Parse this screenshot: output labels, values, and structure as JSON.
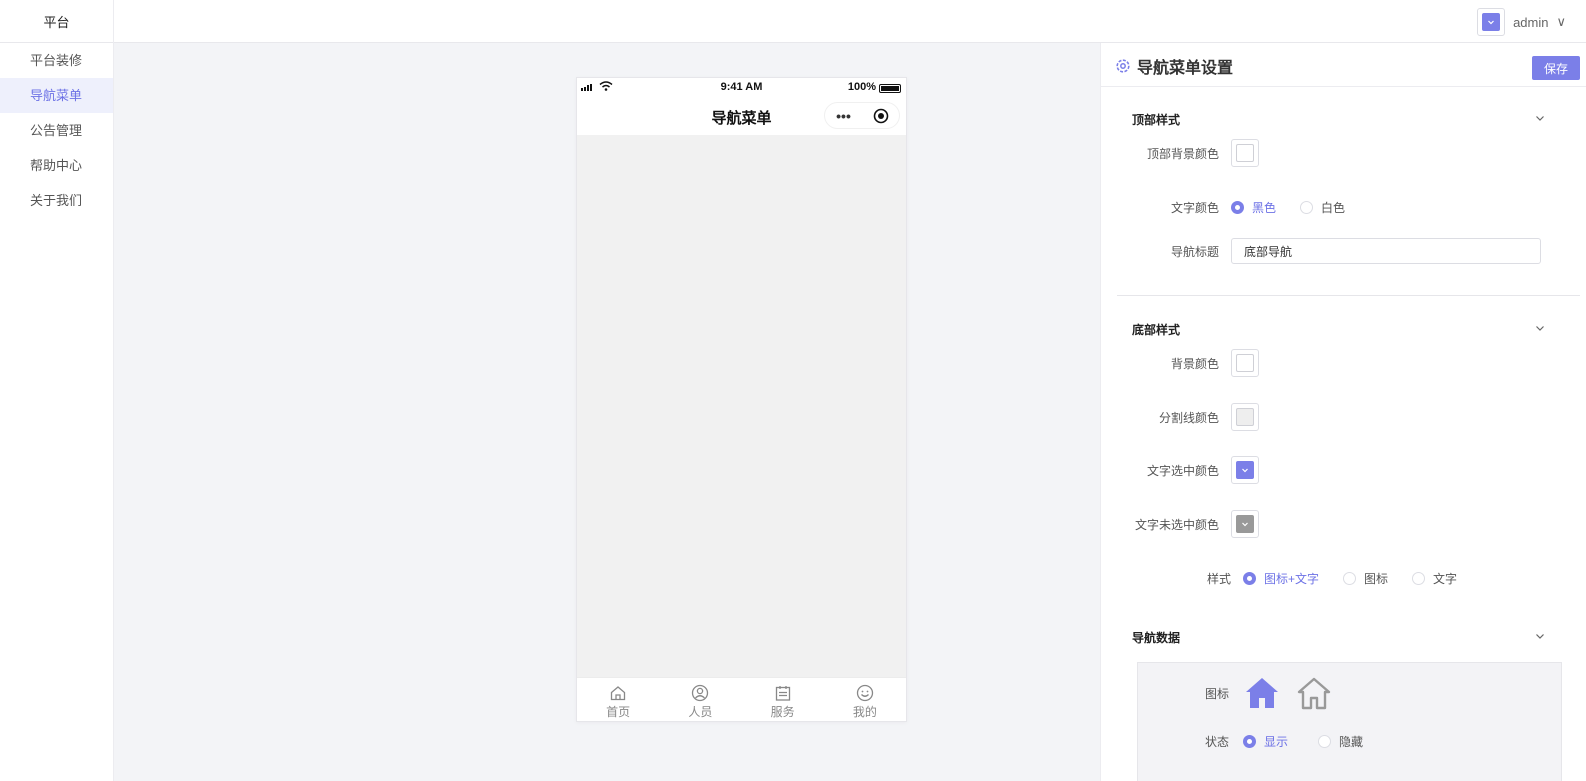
{
  "header": {
    "brand": "平台",
    "user_name": "admin",
    "user_caret": "∨"
  },
  "sidebar": {
    "items": [
      {
        "label": "平台装修"
      },
      {
        "label": "导航菜单"
      },
      {
        "label": "公告管理"
      },
      {
        "label": "帮助中心"
      },
      {
        "label": "关于我们"
      }
    ],
    "active_index": 1
  },
  "phone": {
    "time": "9:41 AM",
    "battery_text": "100%",
    "nav_title": "导航菜单",
    "capsule_more": "•••",
    "tabs": [
      {
        "label": "首页",
        "icon": "home-icon"
      },
      {
        "label": "人员",
        "icon": "person-icon"
      },
      {
        "label": "服务",
        "icon": "calendar-icon"
      },
      {
        "label": "我的",
        "icon": "smile-icon"
      }
    ]
  },
  "panel": {
    "title": "导航菜单设置",
    "save_label": "保存",
    "top_section": {
      "title": "顶部样式",
      "bg_color_label": "顶部背景颜色",
      "bg_color_value": "#ffffff",
      "text_color_label": "文字颜色",
      "text_color_options": [
        "黑色",
        "白色"
      ],
      "text_color_selected": "黑色",
      "nav_title_label": "导航标题",
      "nav_title_value": "底部导航"
    },
    "bottom_section": {
      "title": "底部样式",
      "bg_color_label": "背景颜色",
      "bg_color_value": "#ffffff",
      "divider_color_label": "分割线颜色",
      "divider_color_value": "#eeeeee",
      "active_text_color_label": "文字选中颜色",
      "active_text_color_value": "#7b7fe8",
      "inactive_text_color_label": "文字未选中颜色",
      "inactive_text_color_value": "#999999",
      "style_label": "样式",
      "style_options": [
        "图标+文字",
        "图标",
        "文字"
      ],
      "style_selected": "图标+文字"
    },
    "nav_data_section": {
      "title": "导航数据",
      "icon_label": "图标",
      "status_label": "状态",
      "status_options": [
        "显示",
        "隐藏"
      ],
      "status_selected": "显示"
    }
  },
  "colors": {
    "accent": "#7b7fe8",
    "accent_text": "#6d72e6"
  }
}
